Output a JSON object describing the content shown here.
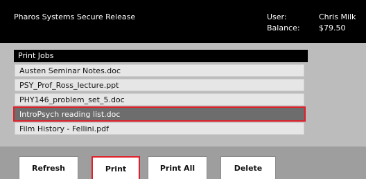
{
  "header": {
    "system_name": "Pharos Systems Secure Release",
    "user_label": "User:",
    "balance_label": "Balance:",
    "user_value": "Chris Milk",
    "balance_value": "$79.50"
  },
  "print_jobs": {
    "header": "Print Jobs",
    "items": [
      {
        "label": "Austen Seminar Notes.doc",
        "selected": false
      },
      {
        "label": "PSY_Prof_Ross_lecture.ppt",
        "selected": false
      },
      {
        "label": "PHY146_problem_set_5.doc",
        "selected": false
      },
      {
        "label": "IntroPsych reading list.doc",
        "selected": true
      },
      {
        "label": "Film History - Fellini.pdf",
        "selected": false
      }
    ]
  },
  "toolbar": {
    "refresh_label": "Refresh",
    "print_label": "Print",
    "print_all_label": "Print All",
    "delete_label": "Delete"
  },
  "colors": {
    "header_bg": "#000000",
    "panel_bg": "#bcbcbc",
    "selected_row_bg": "#6d6d6d",
    "highlight_border": "#e0202a"
  }
}
